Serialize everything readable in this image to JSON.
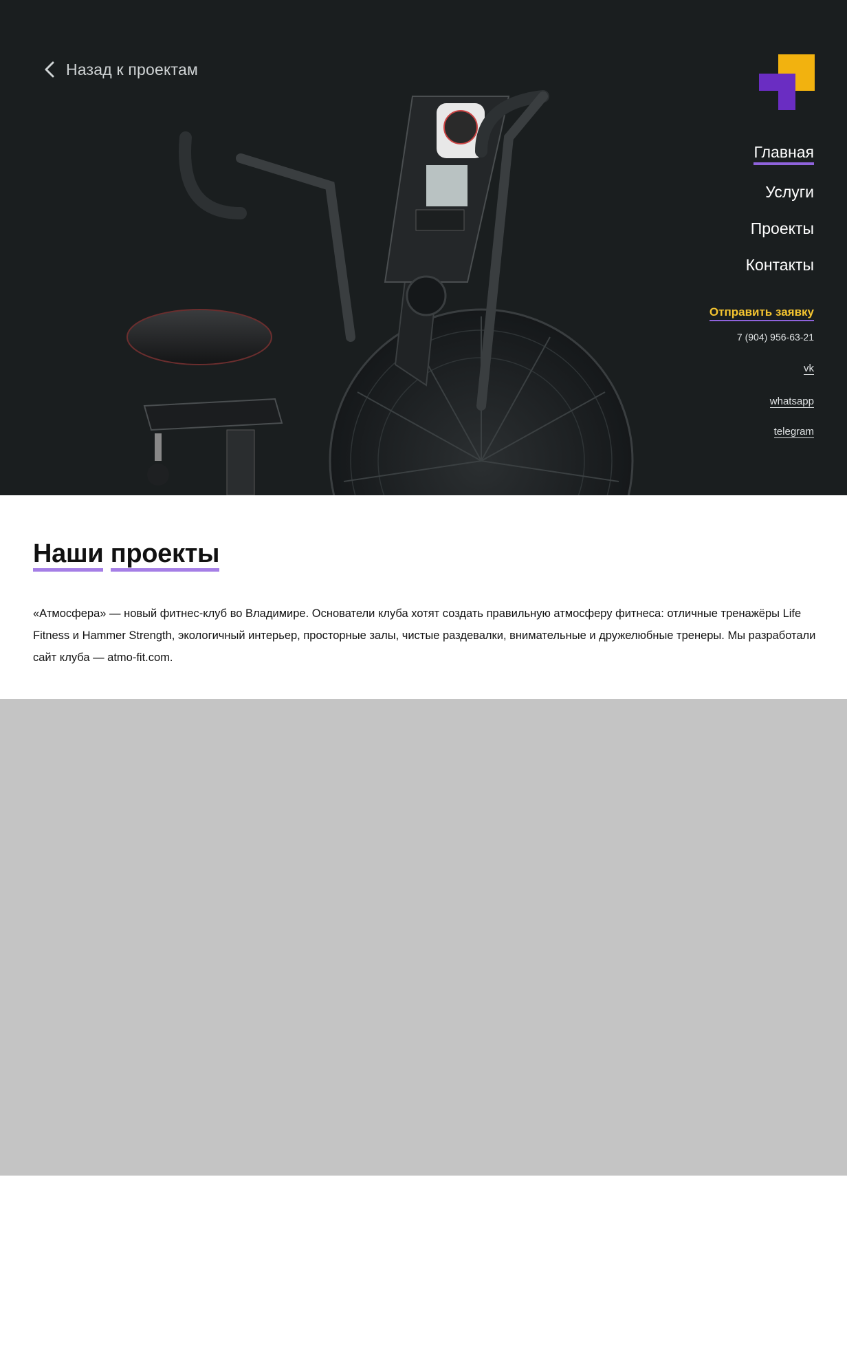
{
  "header": {
    "back_label": "Назад к проектам"
  },
  "nav": {
    "items": [
      {
        "label": "Главная",
        "active": true
      },
      {
        "label": "Услуги",
        "active": false
      },
      {
        "label": "Проекты",
        "active": false
      },
      {
        "label": "Контакты",
        "active": false
      }
    ]
  },
  "contact": {
    "cta_label": "Отправить заявку",
    "phone": "7 (904) 956-63-21",
    "vk": "vk",
    "whatsapp": "whatsapp",
    "telegram": "telegram"
  },
  "main": {
    "heading_word1": "Наши",
    "heading_word2": "проекты",
    "description": "«Атмосфера» — новый фитнес-клуб во Владимире. Основатели клуба хотят создать правильную атмосферу фитнеса: отличные тренажёры Life Fitness и Hammer Strength, экологичный интерьер, просторные залы, чистые раздевалки, внимательные и дружелюбные тренеры. Мы разработали сайт клуба — atmo-fit.com."
  },
  "colors": {
    "hero_bg": "#1a1e1f",
    "accent_purple": "#8f63dc",
    "accent_yellow": "#f4c430",
    "placeholder_gray": "#c4c4c4"
  },
  "icons": {
    "back": "chevron-left-icon",
    "logo": "brand-logo-icon"
  }
}
